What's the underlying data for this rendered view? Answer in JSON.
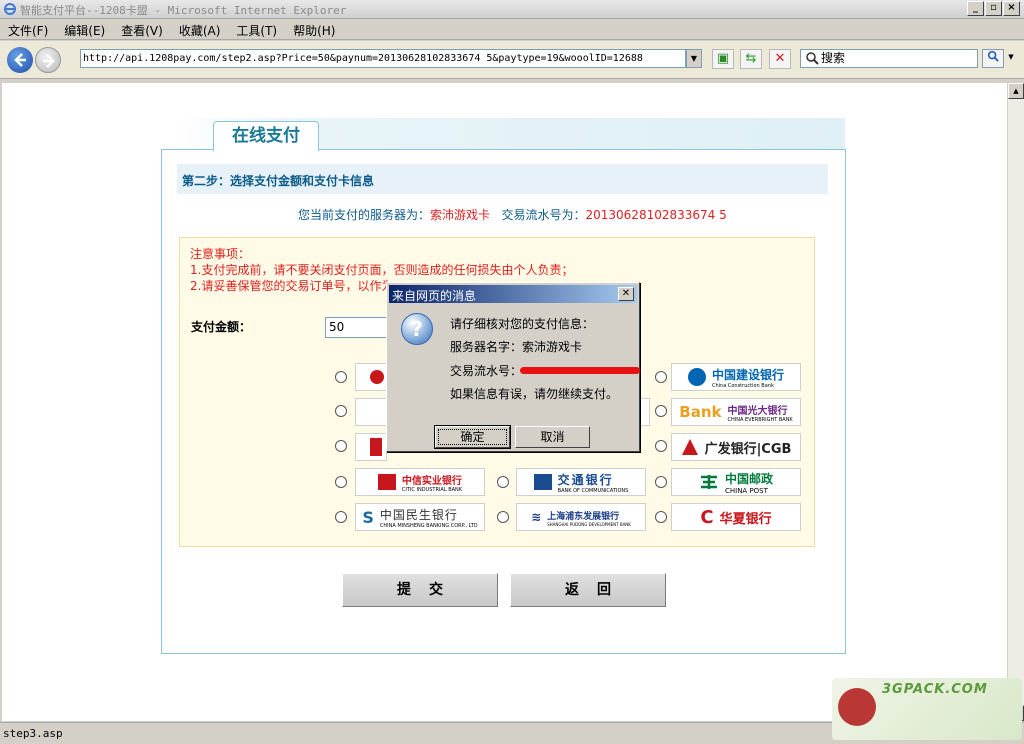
{
  "window": {
    "title": "智能支付平台--1208卡盟 - Microsoft Internet Explorer"
  },
  "menu": [
    "文件(F)",
    "编辑(E)",
    "查看(V)",
    "收藏(A)",
    "工具(T)",
    "帮助(H)"
  ],
  "address": {
    "url": "http://api.1208pay.com/step2.asp?Price=50&paynum=20130628102833674 5&paytype=19&wooolID=12688"
  },
  "search": {
    "placeholder": "搜索"
  },
  "page": {
    "tab_label": "在线支付",
    "step_title": "第二步：选择支付金额和支付卡信息",
    "info_prefix": "您当前支付的服务器为：",
    "server_name": "索沛游戏卡",
    "serial_prefix": "交易流水号为：",
    "serial": "20130628102833674 5",
    "notice_title": "注意事项：",
    "notice_1": "1.支付完成前，请不要关闭支付页面，否则造成的任何损失由个人负责；",
    "notice_2": "2.请妥善保管您的交易订单号，以作为",
    "amount_label": "支付金额：",
    "amount_value": "50",
    "banks": {
      "ccb": {
        "name": "中国建设银行",
        "sub": "China Construction Bank",
        "color": "#0066b3"
      },
      "ceb": {
        "name": "中国光大银行",
        "sub": "CHINA EVERBRIGHT BANK",
        "color": "#6a2a84"
      },
      "cgb": {
        "name": "广发银行|CGB",
        "color": "#c8161d"
      },
      "citic": {
        "name": "中信实业银行",
        "sub": "CITIC INDUSTRIAL BANK",
        "color": "#c8161d"
      },
      "bocom": {
        "name": "交通银行",
        "sub": "BANK OF COMMUNICATIONS",
        "color": "#1a4d8f"
      },
      "post": {
        "name": "中国邮政",
        "sub": "CHINA POST",
        "color": "#007a3d"
      },
      "cmbc": {
        "name": "中国民生银行",
        "sub": "CHINA MINSHENG BANKING CORP., LTD",
        "color": "#1a6aa8"
      },
      "spdb": {
        "name": "上海浦东发展银行",
        "sub": "SHANGHAI PUDONG DEVELOPMENT BANK",
        "color": "#1a3a8a"
      },
      "hxb": {
        "name": "华夏银行",
        "color": "#c8161d"
      }
    },
    "submit": "提交",
    "back": "返回"
  },
  "dialog": {
    "title": "来自网页的消息",
    "line1": "请仔细核对您的支付信息：",
    "line2": "服务器名字：索沛游戏卡",
    "line3": "交易流水号：",
    "line4": "如果信息有误，请勿继续支付。",
    "ok": "确定",
    "cancel": "取消"
  },
  "status": {
    "text": "step3.asp"
  },
  "watermark": {
    "text": "3GPACK.COM"
  }
}
